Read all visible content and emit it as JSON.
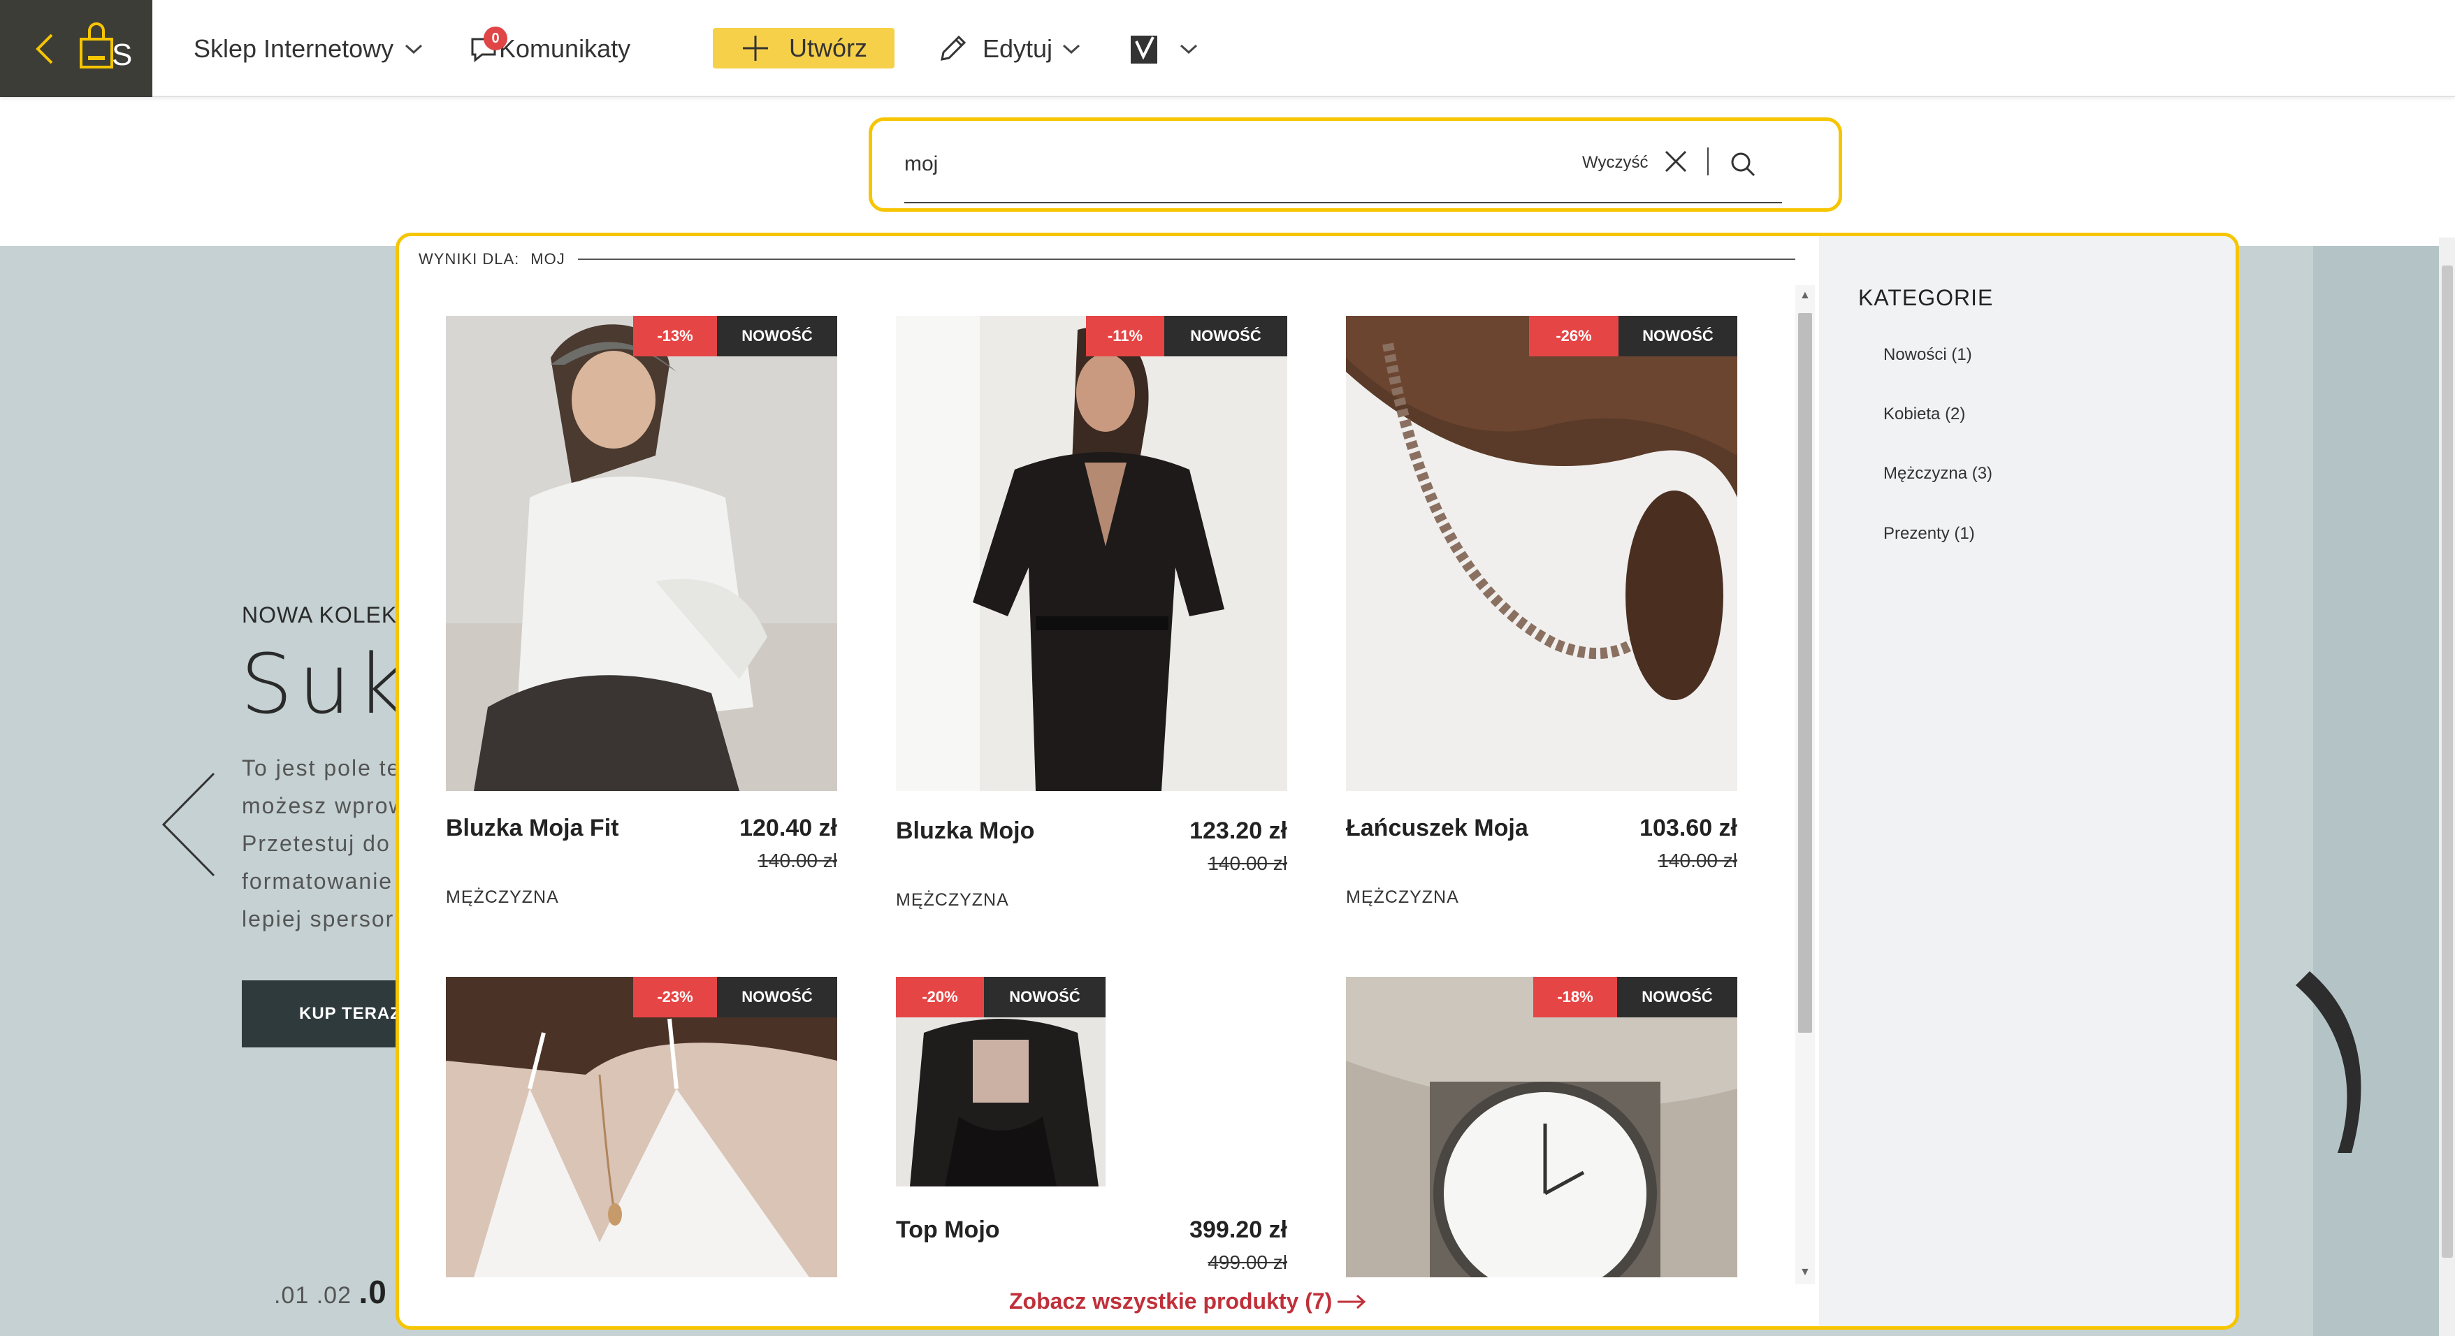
{
  "topbar": {
    "brand_letter": "S",
    "shop_label": "Sklep Internetowy",
    "messages_label": "Komunikaty",
    "messages_count": "0",
    "create_label": "Utwórz",
    "edit_label": "Edytuj"
  },
  "hero": {
    "subtitle": "NOWA KOLEKC",
    "title": "Suk",
    "text_lines": [
      "To jest pole te",
      "możesz wprow",
      "Przetestuj do",
      "formatowanie",
      "lepiej spersor"
    ],
    "button_label": "KUP TERAZ",
    "pages_prefix": ".01 .02",
    "pages_current": ".0"
  },
  "search": {
    "value": "moj",
    "clear_label": "Wyczyść"
  },
  "results": {
    "header_label": "WYNIKI DLA:",
    "query": "MOJ",
    "see_all_label": "Zobacz wszystkie produkty (7)",
    "products": [
      {
        "name": "Bluzka Moja Fit",
        "price": "120.40 zł",
        "old_price": "140.00 zł",
        "category": "MĘŻCZYZNA",
        "discount": "-13%",
        "new_label": "NOWOŚĆ"
      },
      {
        "name": "Bluzka Mojo",
        "price": "123.20 zł",
        "old_price": "140.00 zł",
        "category": "MĘŻCZYZNA",
        "discount": "-11%",
        "new_label": "NOWOŚĆ"
      },
      {
        "name": "Łańcuszek Moja",
        "price": "103.60 zł",
        "old_price": "140.00 zł",
        "category": "MĘŻCZYZNA",
        "discount": "-26%",
        "new_label": "NOWOŚĆ"
      },
      {
        "name": "",
        "price": "",
        "old_price": "",
        "category": "",
        "discount": "-23%",
        "new_label": "NOWOŚĆ"
      },
      {
        "name": "Top Mojo",
        "price": "399.20 zł",
        "old_price": "499.00 zł",
        "category": "",
        "discount": "-20%",
        "new_label": "NOWOŚĆ"
      },
      {
        "name": "",
        "price": "",
        "old_price": "",
        "category": "",
        "discount": "-18%",
        "new_label": "NOWOŚĆ"
      }
    ]
  },
  "categories": {
    "title": "KATEGORIE",
    "items": [
      "Nowości (1)",
      "Kobieta (2)",
      "Mężczyzna (3)",
      "Prezenty (1)"
    ]
  },
  "colors": {
    "accent": "#f6c500",
    "create_button": "#f7d04a",
    "discount_badge": "#e64545",
    "new_badge": "#2d2d2d",
    "see_all_link": "#c0303a"
  }
}
